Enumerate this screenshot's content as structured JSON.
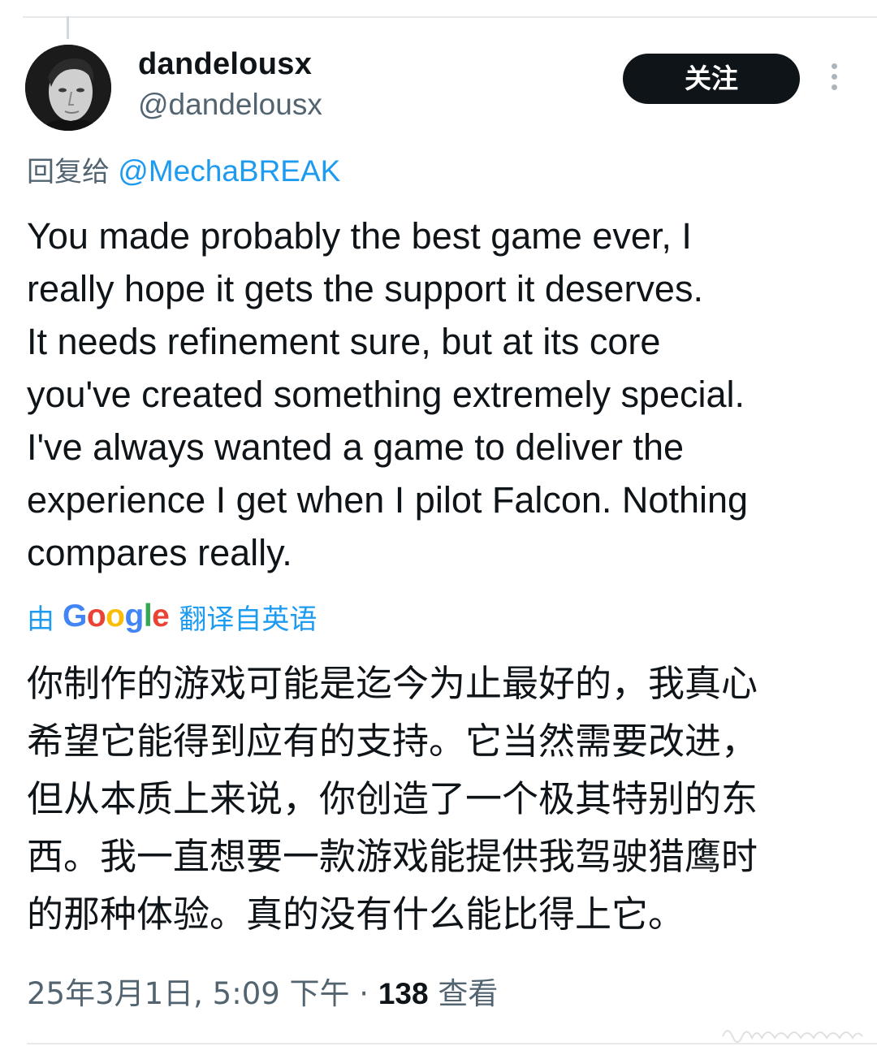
{
  "author": {
    "display_name": "dandelousx",
    "handle": "@dandelousx"
  },
  "actions": {
    "follow_label": "关注"
  },
  "reply": {
    "prefix": "回复给",
    "mention": "@MechaBREAK"
  },
  "tweet": {
    "text": "You made probably the best game ever, I\nreally hope it gets the support it deserves.\nIt needs refinement sure, but at its core\nyou've created something extremely special.\nI've always wanted a game to deliver the\nexperience I get when I pilot Falcon. Nothing\ncompares really."
  },
  "translation": {
    "by": "由",
    "provider": "Google",
    "action": "翻译自英语",
    "text": "你制作的游戏可能是迄今为止最好的，我真心\n希望它能得到应有的支持。它当然需要改进，\n但从本质上来说，你创造了一个极其特别的东\n西。我一直想要一款游戏能提供我驾驶猎鹰时\n的那种体验。真的没有什么能比得上它。"
  },
  "meta": {
    "timestamp": "25年3月1日, 5:09 下午",
    "separator": " · ",
    "views": "138",
    "views_label": " 查看"
  },
  "colors": {
    "link": "#1d9bf0",
    "secondary_text": "#536471",
    "primary_text": "#0f1419",
    "follow_bg": "#0f1419"
  }
}
